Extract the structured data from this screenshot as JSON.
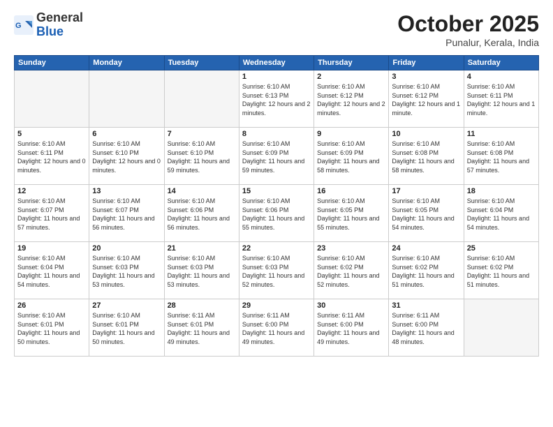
{
  "header": {
    "logo_general": "General",
    "logo_blue": "Blue",
    "month_title": "October 2025",
    "location": "Punalur, Kerala, India"
  },
  "days_of_week": [
    "Sunday",
    "Monday",
    "Tuesday",
    "Wednesday",
    "Thursday",
    "Friday",
    "Saturday"
  ],
  "weeks": [
    [
      {
        "day": "",
        "info": ""
      },
      {
        "day": "",
        "info": ""
      },
      {
        "day": "",
        "info": ""
      },
      {
        "day": "1",
        "info": "Sunrise: 6:10 AM\nSunset: 6:13 PM\nDaylight: 12 hours\nand 2 minutes."
      },
      {
        "day": "2",
        "info": "Sunrise: 6:10 AM\nSunset: 6:12 PM\nDaylight: 12 hours\nand 2 minutes."
      },
      {
        "day": "3",
        "info": "Sunrise: 6:10 AM\nSunset: 6:12 PM\nDaylight: 12 hours\nand 1 minute."
      },
      {
        "day": "4",
        "info": "Sunrise: 6:10 AM\nSunset: 6:11 PM\nDaylight: 12 hours\nand 1 minute."
      }
    ],
    [
      {
        "day": "5",
        "info": "Sunrise: 6:10 AM\nSunset: 6:11 PM\nDaylight: 12 hours\nand 0 minutes."
      },
      {
        "day": "6",
        "info": "Sunrise: 6:10 AM\nSunset: 6:10 PM\nDaylight: 12 hours\nand 0 minutes."
      },
      {
        "day": "7",
        "info": "Sunrise: 6:10 AM\nSunset: 6:10 PM\nDaylight: 11 hours\nand 59 minutes."
      },
      {
        "day": "8",
        "info": "Sunrise: 6:10 AM\nSunset: 6:09 PM\nDaylight: 11 hours\nand 59 minutes."
      },
      {
        "day": "9",
        "info": "Sunrise: 6:10 AM\nSunset: 6:09 PM\nDaylight: 11 hours\nand 58 minutes."
      },
      {
        "day": "10",
        "info": "Sunrise: 6:10 AM\nSunset: 6:08 PM\nDaylight: 11 hours\nand 58 minutes."
      },
      {
        "day": "11",
        "info": "Sunrise: 6:10 AM\nSunset: 6:08 PM\nDaylight: 11 hours\nand 57 minutes."
      }
    ],
    [
      {
        "day": "12",
        "info": "Sunrise: 6:10 AM\nSunset: 6:07 PM\nDaylight: 11 hours\nand 57 minutes."
      },
      {
        "day": "13",
        "info": "Sunrise: 6:10 AM\nSunset: 6:07 PM\nDaylight: 11 hours\nand 56 minutes."
      },
      {
        "day": "14",
        "info": "Sunrise: 6:10 AM\nSunset: 6:06 PM\nDaylight: 11 hours\nand 56 minutes."
      },
      {
        "day": "15",
        "info": "Sunrise: 6:10 AM\nSunset: 6:06 PM\nDaylight: 11 hours\nand 55 minutes."
      },
      {
        "day": "16",
        "info": "Sunrise: 6:10 AM\nSunset: 6:05 PM\nDaylight: 11 hours\nand 55 minutes."
      },
      {
        "day": "17",
        "info": "Sunrise: 6:10 AM\nSunset: 6:05 PM\nDaylight: 11 hours\nand 54 minutes."
      },
      {
        "day": "18",
        "info": "Sunrise: 6:10 AM\nSunset: 6:04 PM\nDaylight: 11 hours\nand 54 minutes."
      }
    ],
    [
      {
        "day": "19",
        "info": "Sunrise: 6:10 AM\nSunset: 6:04 PM\nDaylight: 11 hours\nand 54 minutes."
      },
      {
        "day": "20",
        "info": "Sunrise: 6:10 AM\nSunset: 6:03 PM\nDaylight: 11 hours\nand 53 minutes."
      },
      {
        "day": "21",
        "info": "Sunrise: 6:10 AM\nSunset: 6:03 PM\nDaylight: 11 hours\nand 53 minutes."
      },
      {
        "day": "22",
        "info": "Sunrise: 6:10 AM\nSunset: 6:03 PM\nDaylight: 11 hours\nand 52 minutes."
      },
      {
        "day": "23",
        "info": "Sunrise: 6:10 AM\nSunset: 6:02 PM\nDaylight: 11 hours\nand 52 minutes."
      },
      {
        "day": "24",
        "info": "Sunrise: 6:10 AM\nSunset: 6:02 PM\nDaylight: 11 hours\nand 51 minutes."
      },
      {
        "day": "25",
        "info": "Sunrise: 6:10 AM\nSunset: 6:02 PM\nDaylight: 11 hours\nand 51 minutes."
      }
    ],
    [
      {
        "day": "26",
        "info": "Sunrise: 6:10 AM\nSunset: 6:01 PM\nDaylight: 11 hours\nand 50 minutes."
      },
      {
        "day": "27",
        "info": "Sunrise: 6:10 AM\nSunset: 6:01 PM\nDaylight: 11 hours\nand 50 minutes."
      },
      {
        "day": "28",
        "info": "Sunrise: 6:11 AM\nSunset: 6:01 PM\nDaylight: 11 hours\nand 49 minutes."
      },
      {
        "day": "29",
        "info": "Sunrise: 6:11 AM\nSunset: 6:00 PM\nDaylight: 11 hours\nand 49 minutes."
      },
      {
        "day": "30",
        "info": "Sunrise: 6:11 AM\nSunset: 6:00 PM\nDaylight: 11 hours\nand 49 minutes."
      },
      {
        "day": "31",
        "info": "Sunrise: 6:11 AM\nSunset: 6:00 PM\nDaylight: 11 hours\nand 48 minutes."
      },
      {
        "day": "",
        "info": ""
      }
    ]
  ]
}
